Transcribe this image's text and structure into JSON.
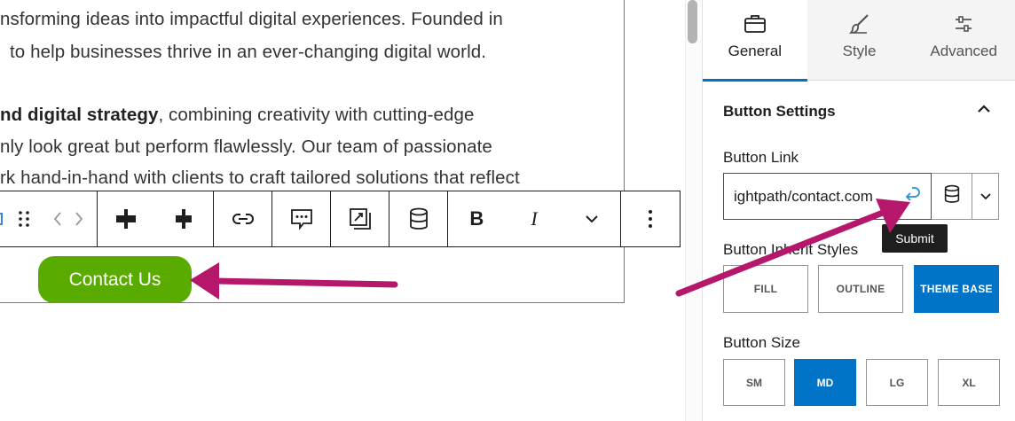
{
  "editor": {
    "paragraphs": [
      "nsforming ideas into impactful digital experiences. Founded in",
      "to help businesses thrive in an ever-changing digital world."
    ],
    "para3_bold": "nd digital strategy",
    "para3_rest": ", combining creativity with cutting-edge",
    "para4": "nly look great but perform flawlessly. Our team of passionate",
    "para5": "rk hand-in-hand with clients to craft tailored solutions that reflect",
    "contact_button_label": "Contact Us"
  },
  "toolbar": {
    "items": [
      "block-icon",
      "drag-handle-icon",
      "move-arrows-icon",
      "justify-left-icon",
      "justify-center-icon",
      "link-icon",
      "comment-icon",
      "image-icon",
      "database-icon",
      "bold-icon",
      "italic-icon",
      "chevron-down-icon",
      "more-options-icon"
    ],
    "bold_label": "B",
    "italic_label": "I"
  },
  "sidebar": {
    "tabs": [
      {
        "label": "General",
        "icon": "briefcase-icon",
        "active": true
      },
      {
        "label": "Style",
        "icon": "brush-icon",
        "active": false
      },
      {
        "label": "Advanced",
        "icon": "sliders-icon",
        "active": false
      }
    ],
    "section_title": "Button Settings",
    "link_label": "Button Link",
    "link_value": "ightpath/contact.com",
    "tooltip": "Submit",
    "inherit_label": "Button Inherit Styles",
    "inherit_options": [
      {
        "label": "FILL",
        "active": false
      },
      {
        "label": "OUTLINE",
        "active": false
      },
      {
        "label": "THEME BASE",
        "active": true
      }
    ],
    "size_label": "Button Size",
    "size_options": [
      {
        "label": "SM",
        "active": false
      },
      {
        "label": "MD",
        "active": true
      },
      {
        "label": "LG",
        "active": false
      },
      {
        "label": "XL",
        "active": false
      }
    ]
  },
  "colors": {
    "accent_blue": "#0073c6",
    "button_green": "#5aab00",
    "annotation_arrow": "#b5186b"
  }
}
